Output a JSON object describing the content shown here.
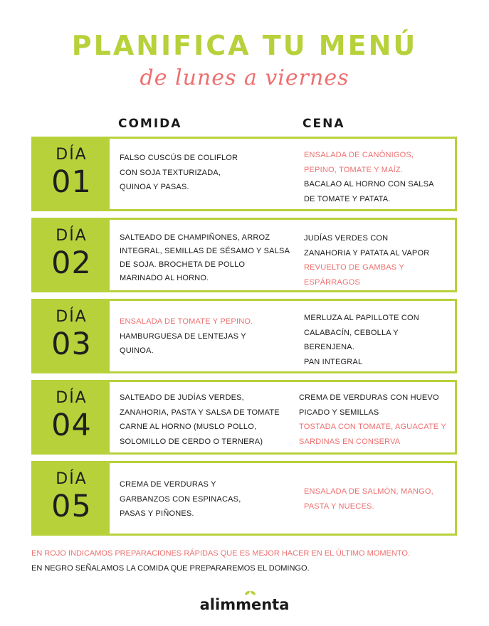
{
  "title": "PLANIFICA TU MENÚ",
  "subtitle": "de lunes a viernes",
  "headers": {
    "comida": "COMIDA",
    "cena": "CENA"
  },
  "days": [
    {
      "label": "DÍA",
      "number": "01",
      "comida": [
        {
          "text": "FALSO CUSCÚS DE COLIFLOR",
          "red": false
        },
        {
          "text": "CON SOJA TEXTURIZADA,",
          "red": false
        },
        {
          "text": "QUINOA Y PASAS.",
          "red": false
        }
      ],
      "cena": [
        {
          "text": "ENSALADA DE CANÓNIGOS,",
          "red": true
        },
        {
          "text": "PEPINO, TOMATE Y MAÍZ.",
          "red": true
        },
        {
          "text": "BACALAO AL HORNO CON SALSA",
          "red": false
        },
        {
          "text": "DE TOMATE Y PATATA.",
          "red": false
        }
      ]
    },
    {
      "label": "DÍA",
      "number": "02",
      "comida": [
        {
          "text": "SALTEADO DE CHAMPIÑONES, ARROZ",
          "red": false
        },
        {
          "text": "INTEGRAL, SEMILLAS DE SÉSAMO Y SALSA",
          "red": false
        },
        {
          "text": "DE SOJA. BROCHETA DE POLLO",
          "red": false
        },
        {
          "text": "MARINADO AL HORNO.",
          "red": false
        }
      ],
      "cena": [
        {
          "text": "JUDÍAS VERDES CON",
          "red": false
        },
        {
          "text": "ZANAHORIA Y PATATA AL VAPOR",
          "red": false
        },
        {
          "text": "REVUELTO DE GAMBAS Y",
          "red": true
        },
        {
          "text": "ESPÁRRAGOS",
          "red": true
        }
      ]
    },
    {
      "label": "DÍA",
      "number": "03",
      "comida": [
        {
          "text": "ENSALADA DE TOMATE Y PEPINO.",
          "red": true
        },
        {
          "text": "HAMBURGUESA DE LENTEJAS Y",
          "red": false
        },
        {
          "text": "QUINOA.",
          "red": false
        }
      ],
      "cena": [
        {
          "text": "MERLUZA AL PAPILLOTE CON",
          "red": false
        },
        {
          "text": "CALABACÍN, CEBOLLA Y",
          "red": false
        },
        {
          "text": "BERENJENA.",
          "red": false
        },
        {
          "text": "PAN INTEGRAL",
          "red": false
        }
      ]
    },
    {
      "label": "DÍA",
      "number": "04",
      "comida": [
        {
          "text": "SALTEADO DE JUDÍAS VERDES,",
          "red": false
        },
        {
          "text": "ZANAHORIA, PASTA Y SALSA DE TOMATE",
          "red": false
        },
        {
          "text": "CARNE AL HORNO (MUSLO POLLO,",
          "red": false
        },
        {
          "text": "SOLOMILLO DE CERDO O TERNERA)",
          "red": false
        }
      ],
      "cena": [
        {
          "text": "CREMA DE VERDURAS CON HUEVO",
          "red": false
        },
        {
          "text": "PICADO Y SEMILLAS",
          "red": false
        },
        {
          "text": "TOSTADA CON TOMATE, AGUACATE Y",
          "red": true
        },
        {
          "text": "SARDINAS EN CONSERVA",
          "red": true
        }
      ]
    },
    {
      "label": "DÍA",
      "number": "05",
      "comida": [
        {
          "text": "CREMA DE VERDURAS Y",
          "red": false
        },
        {
          "text": "GARBANZOS CON ESPINACAS,",
          "red": false
        },
        {
          "text": "PASAS Y PIÑONES.",
          "red": false
        }
      ],
      "cena": [
        {
          "text": "ENSALADA DE SALMÓN, MANGO,",
          "red": true
        },
        {
          "text": "PASTA Y NUECES.",
          "red": true
        }
      ]
    }
  ],
  "footnotes": {
    "red_note": "EN ROJO INDICAMOS PREPARACIONES RÁPIDAS QUE ES MEJOR HACER EN EL ÚLTIMO MOMENTO.",
    "black_note": "EN NEGRO SEÑALAMOS LA COMIDA QUE PREPARAREMOS EL DOMINGO."
  },
  "logo": {
    "text": "alimmenta",
    "icon": "leaf-icon"
  },
  "colors": {
    "green": "#b7d13b",
    "red": "#ee6f6f",
    "text": "#1a1a1a"
  }
}
